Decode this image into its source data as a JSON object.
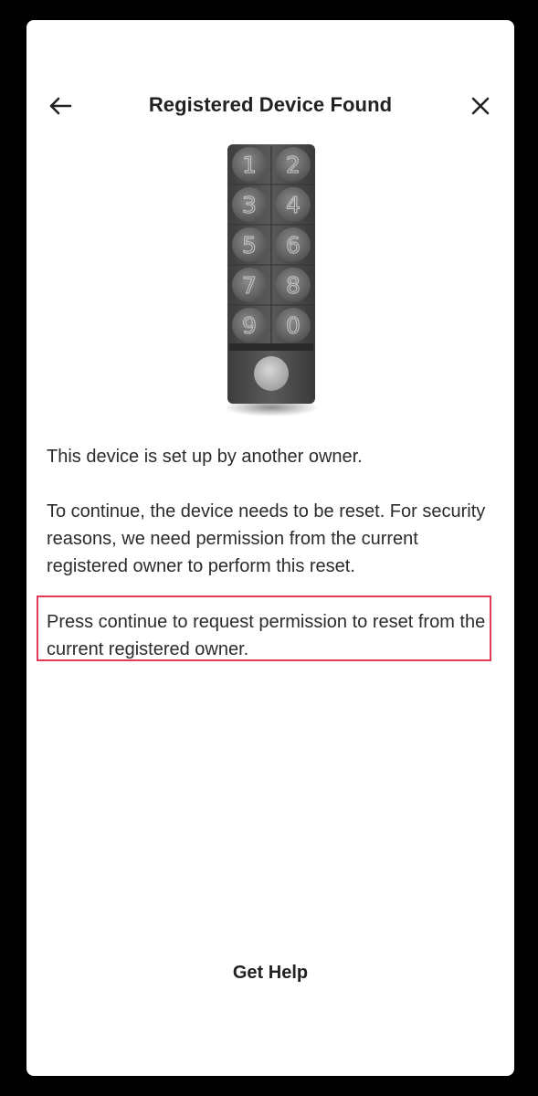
{
  "header": {
    "title": "Registered Device Found"
  },
  "device": {
    "keys": [
      "1",
      "2",
      "3",
      "4",
      "5",
      "6",
      "7",
      "8",
      "9",
      "0"
    ]
  },
  "content": {
    "line1": "This device is set up by another owner.",
    "line2": "To continue, the device needs to be reset. For security reasons, we need permission from the current registered owner to perform this reset.",
    "line3": "Press continue to request permission to reset from the current registered owner."
  },
  "footer": {
    "help_label": "Get Help"
  },
  "colors": {
    "highlight_border": "#e0395a",
    "background": "#000000",
    "card": "#ffffff"
  }
}
